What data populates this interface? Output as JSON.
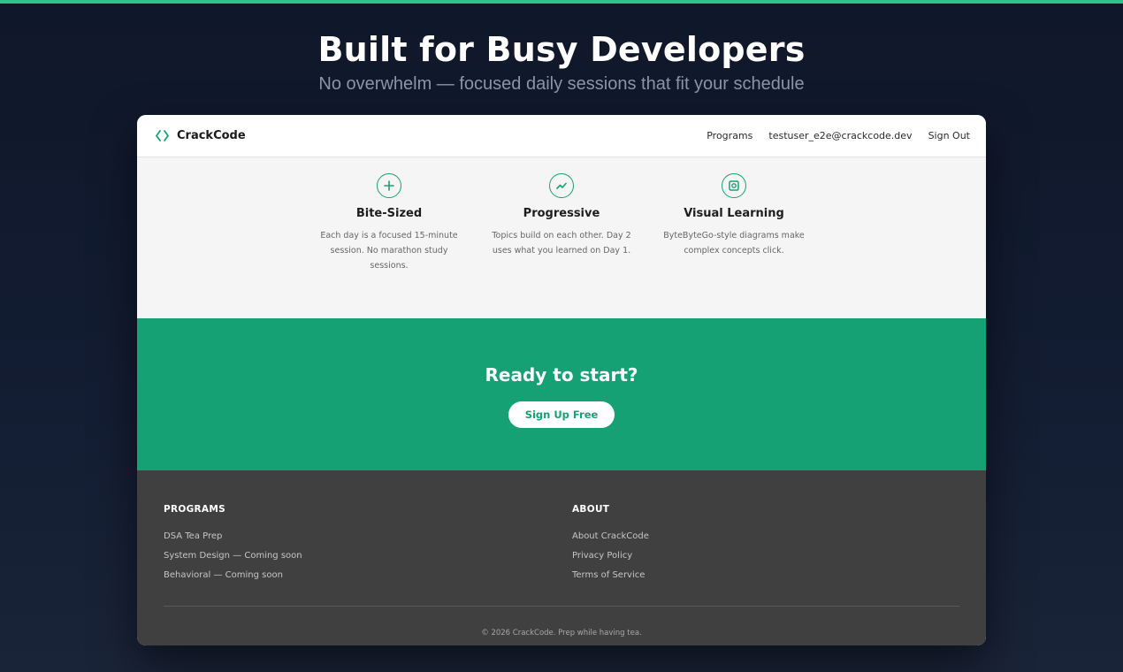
{
  "hero": {
    "title": "Built for Busy Developers",
    "subtitle": "No overwhelm — focused daily sessions that fit your schedule"
  },
  "nav": {
    "brand": "CrackCode",
    "brand_icon": "code-brackets-icon",
    "links": [
      "Programs",
      "testuser_e2e@crackcode.dev",
      "Sign Out"
    ]
  },
  "features": [
    {
      "icon": "plus-icon",
      "title": "Bite-Sized",
      "description": "Each day is a focused 15-minute session. No marathon study sessions."
    },
    {
      "icon": "trend-up-icon",
      "title": "Progressive",
      "description": "Topics build on each other. Day 2 uses what you learned on Day 1."
    },
    {
      "icon": "diagram-icon",
      "title": "Visual Learning",
      "description": "ByteByteGo-style diagrams make complex concepts click."
    }
  ],
  "cta": {
    "title": "Ready to start?",
    "button": "Sign Up Free"
  },
  "footer": {
    "programs": {
      "heading": "PROGRAMS",
      "items": [
        "DSA Tea Prep",
        "System Design — Coming soon",
        "Behavioral — Coming soon"
      ]
    },
    "about": {
      "heading": "ABOUT",
      "items": [
        "About CrackCode",
        "Privacy Policy",
        "Terms of Service"
      ]
    },
    "copyright": "© 2026 CrackCode. Prep while having tea."
  },
  "colors": {
    "accent": "#16a174",
    "top_bar": "#2fc28a",
    "background": "#0f1729",
    "footer": "#404040"
  }
}
